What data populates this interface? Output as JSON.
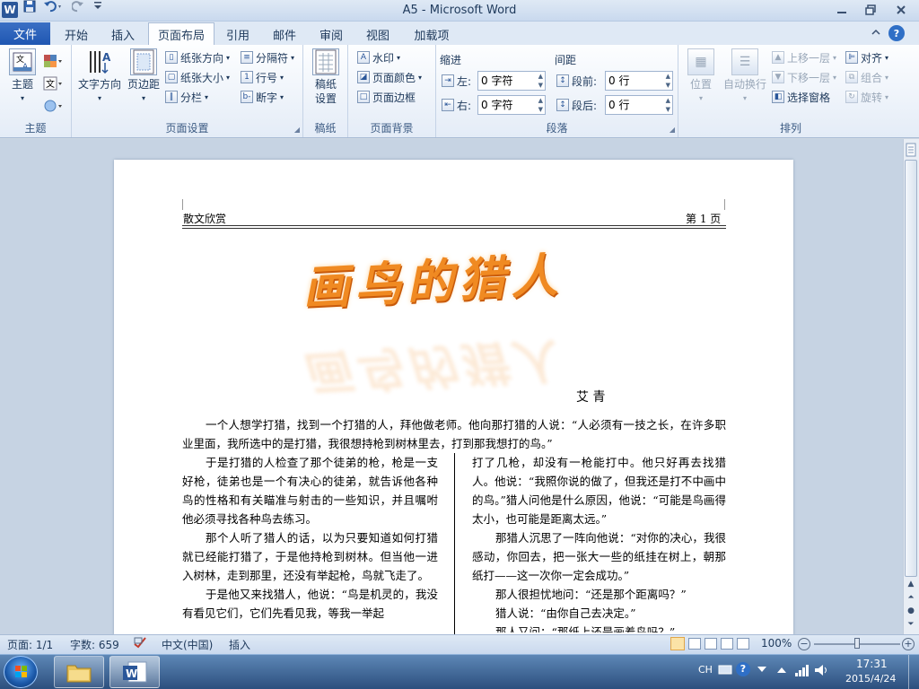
{
  "window": {
    "app_logo": "W",
    "title": "A5 - Microsoft Word",
    "qat_icons": [
      "save-icon",
      "undo-icon",
      "redo-icon",
      "customize-icon"
    ]
  },
  "tabs": {
    "file": "文件",
    "items": [
      "开始",
      "插入",
      "页面布局",
      "引用",
      "邮件",
      "审阅",
      "视图",
      "加载项"
    ],
    "active_index": 2
  },
  "ribbon": {
    "themes": {
      "label": "主题",
      "button": "主题"
    },
    "page_setup": {
      "label": "页面设置",
      "text_direction": "文字方向",
      "margins": "页边距",
      "orientation": "纸张方向",
      "size": "纸张大小",
      "columns": "分栏",
      "breaks": "分隔符",
      "line_numbers": "行号",
      "hyphenation": "断字"
    },
    "manuscript": {
      "label": "稿纸",
      "button": "稿纸\n设置"
    },
    "page_background": {
      "label": "页面背景",
      "watermark": "水印",
      "page_color": "页面颜色",
      "page_borders": "页面边框"
    },
    "paragraph": {
      "label": "段落",
      "indent_title": "缩进",
      "spacing_title": "间距",
      "left_label": "左:",
      "left_value": "0 字符",
      "right_label": "右:",
      "right_value": "0 字符",
      "before_label": "段前:",
      "before_value": "0 行",
      "after_label": "段后:",
      "after_value": "0 行"
    },
    "arrange": {
      "label": "排列",
      "position": "位置",
      "wrap": "自动换行",
      "bring_forward": "上移一层",
      "send_backward": "下移一层",
      "selection_pane": "选择窗格",
      "align": "对齐",
      "group": "组合",
      "rotate": "旋转"
    }
  },
  "document": {
    "header_left": "散文欣赏",
    "header_right": "第 1 页",
    "art_title": "画鸟的猎人",
    "author": "艾 青",
    "intro": "一个人想学打猎，找到一个打猎的人，拜他做老师。他向那打猎的人说：“人必须有一技之长，在许多职业里面，我所选中的是打猎，我很想持枪到树林里去，打到那我想打的鸟。”",
    "col1": [
      "于是打猎的人检查了那个徒弟的枪，枪是一支好枪，徒弟也是一个有决心的徒弟，就告诉他各种鸟的性格和有关瞄准与射击的一些知识，并且嘱咐他必须寻找各种鸟去练习。",
      "那个人听了猎人的话，以为只要知道如何打猎就已经能打猎了，于是他持枪到树林。但当他一进入树林，走到那里，还没有举起枪，鸟就飞走了。",
      "于是他又来找猎人，他说：“鸟是机灵的，我没有看见它们，它们先看见我，等我一举起"
    ],
    "col2": [
      "打了几枪，却没有一枪能打中。他只好再去找猎人。他说：“我照你说的做了，但我还是打不中画中的鸟。”猎人问他是什么原因，他说：“可能是鸟画得太小，也可能是距离太远。”",
      "那猎人沉思了一阵向他说：“对你的决心，我很感动，你回去，把一张大一些的纸挂在树上，朝那纸打——这一次你一定会成功。”",
      "那人很担忧地问：“还是那个距离吗？”",
      "猎人说：“由你自己去决定。”",
      "那人又问：“那纸上还是画着鸟吗？”"
    ]
  },
  "status": {
    "page": "页面: 1/1",
    "words": "字数: 659",
    "language": "中文(中国)",
    "mode": "插入",
    "zoom": "100%",
    "zoom_fraction": 0.5
  },
  "taskbar": {
    "lang": "CH",
    "time": "17:31",
    "date": "2015/4/24"
  }
}
